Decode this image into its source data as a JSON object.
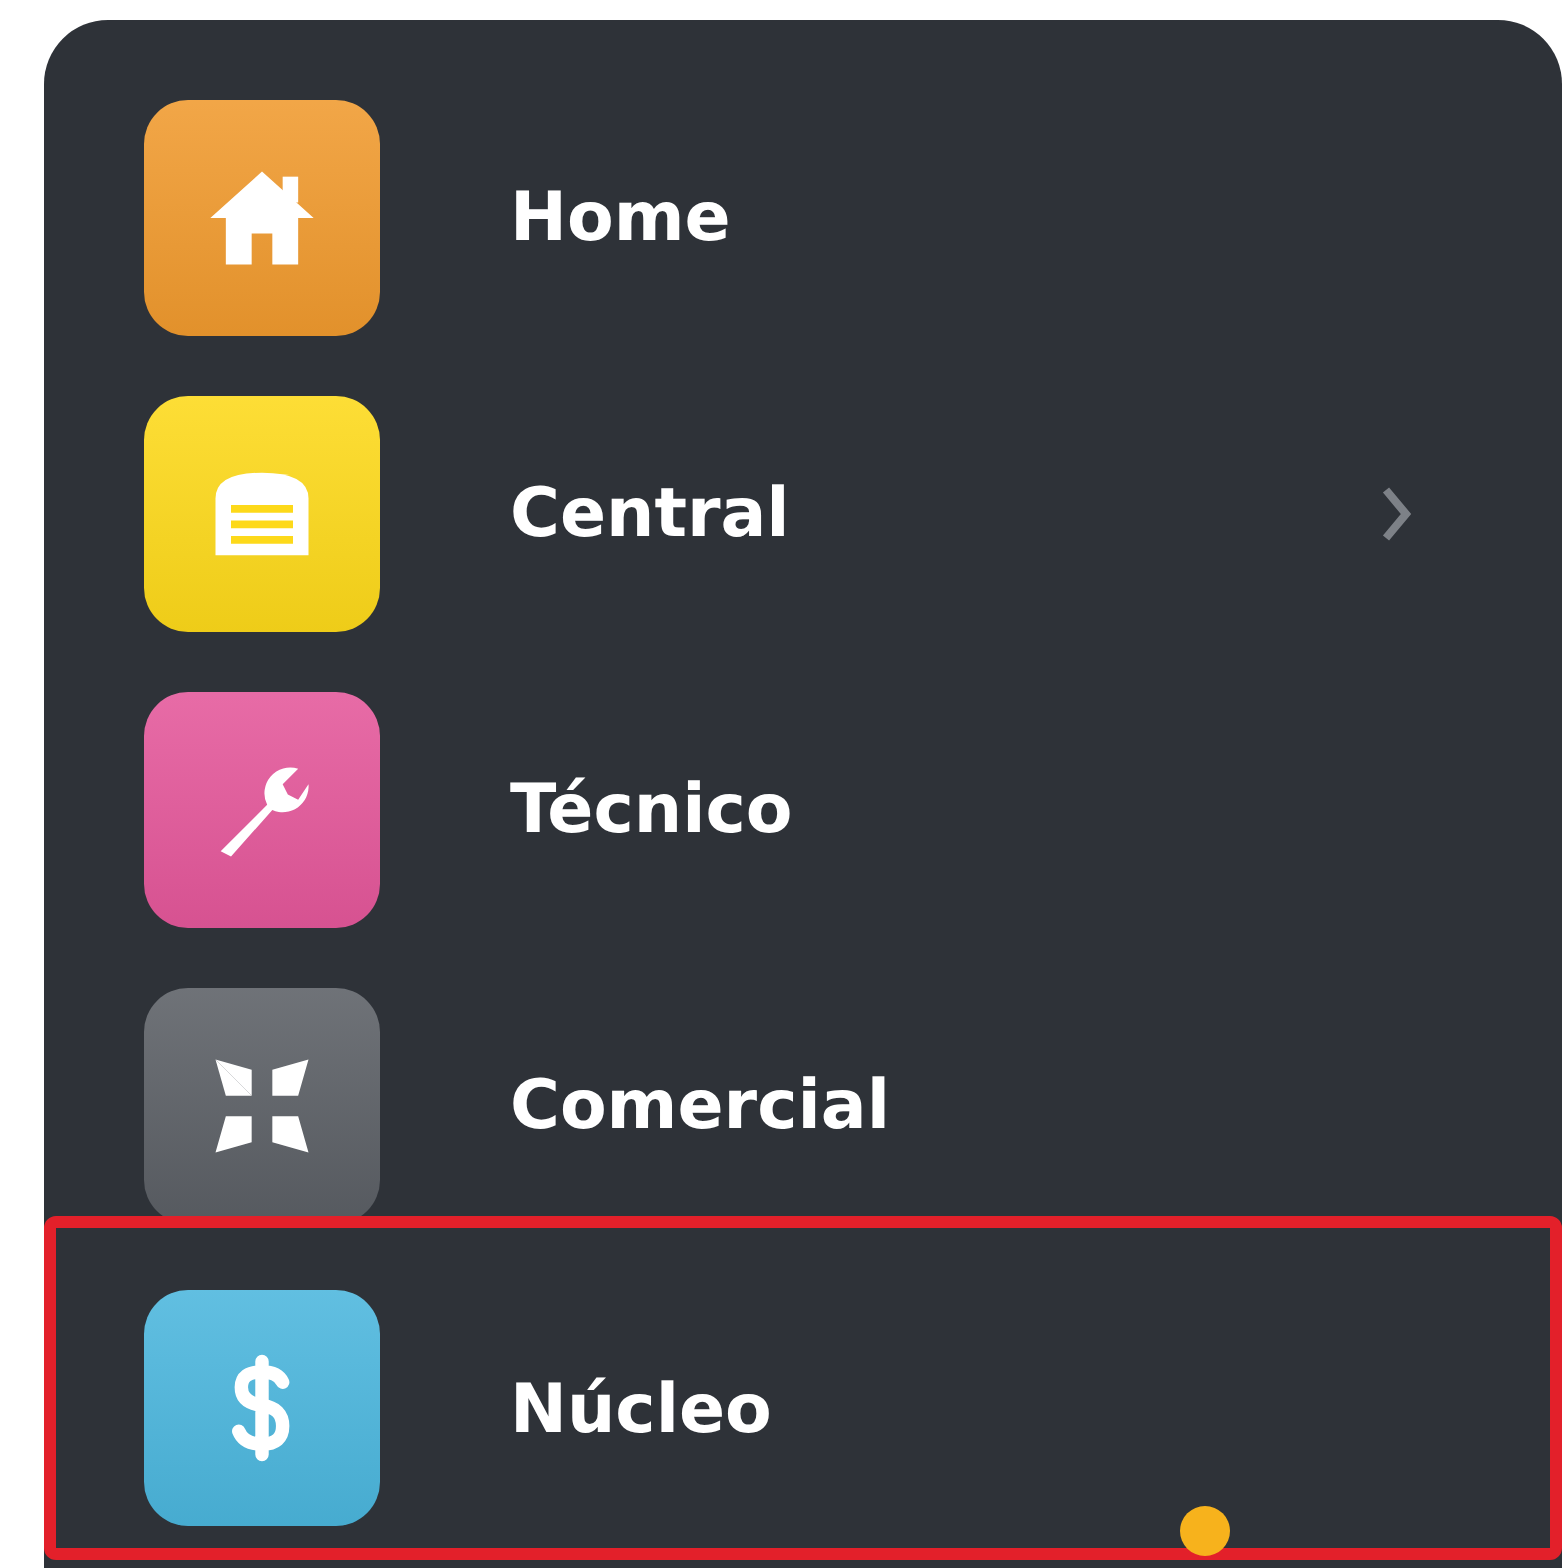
{
  "menu": {
    "items": [
      {
        "label": "Home",
        "color": "#f09a2e",
        "kind": "house",
        "has_submenu": false,
        "highlighted": false
      },
      {
        "label": "Central",
        "color": "#fdd91a",
        "kind": "garage",
        "has_submenu": true,
        "highlighted": false
      },
      {
        "label": "Técnico",
        "color": "#e4579a",
        "kind": "wrench",
        "has_submenu": false,
        "highlighted": false
      },
      {
        "label": "Comercial",
        "color": "#5b5f65",
        "kind": "arrows",
        "has_submenu": false,
        "highlighted": false
      },
      {
        "label": "Núcleo",
        "color": "#4bb6dd",
        "kind": "dollar",
        "has_submenu": false,
        "highlighted": true
      }
    ]
  }
}
